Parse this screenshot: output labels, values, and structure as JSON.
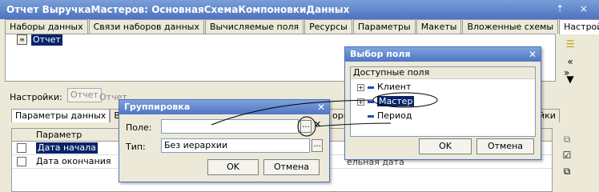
{
  "window": {
    "title": "Отчет ВыручкаМастеров: ОсновнаяСхемаКомпоновкиДанных",
    "controls": "⇡ ×"
  },
  "tabs": [
    "Наборы данных",
    "Связи наборов данных",
    "Вычисляемые поля",
    "Ресурсы",
    "Параметры",
    "Макеты",
    "Вложенные схемы",
    "Настройки"
  ],
  "structure": {
    "root_item": "Отчет"
  },
  "settings": {
    "label": "Настройки:",
    "btn1": "Отчет",
    "btn2": "Отчет"
  },
  "lower_tabs": [
    "Параметры данных",
    "Выб"
  ],
  "lower_tabs_right": {
    "t1": "орм",
    "t2": "йки"
  },
  "params_grid": {
    "header": "Параметр",
    "rows": [
      {
        "name": "Дата начала",
        "selected": true
      },
      {
        "name": "Дата окончания",
        "selected": false
      }
    ],
    "partial_text": "ельная дата"
  },
  "grouping_dialog": {
    "title": "Группировка",
    "field_label": "Поле:",
    "field_value": "",
    "type_label": "Тип:",
    "type_value": "Без иерархии",
    "ok": "OK",
    "cancel": "Отмена"
  },
  "field_picker_dialog": {
    "title": "Выбор поля",
    "available_header": "Доступные поля",
    "items": [
      "Клиент",
      "Мастер",
      "Период"
    ],
    "ok": "OK",
    "cancel": "Отмена"
  },
  "colors": {
    "accent": "#4d72c2",
    "selection": "#0a246a"
  }
}
